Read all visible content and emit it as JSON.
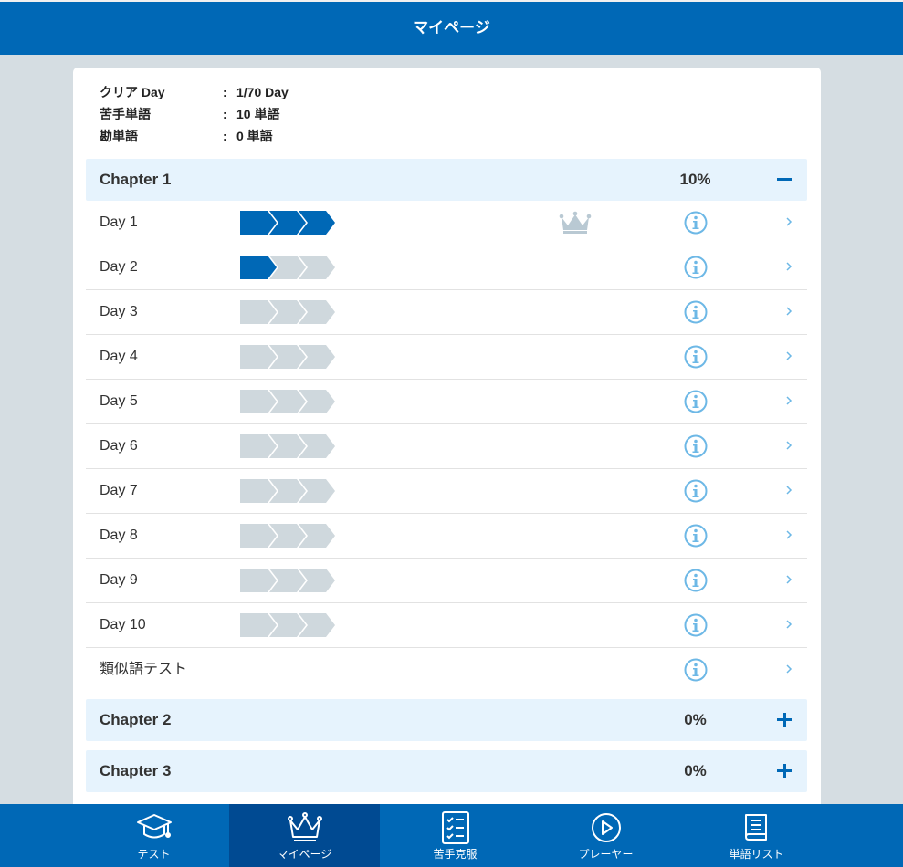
{
  "header": {
    "title": "マイページ"
  },
  "summary": [
    {
      "label": "クリア Day",
      "sep": ":",
      "value": "1/70 Day"
    },
    {
      "label": "苦手単語",
      "sep": ":",
      "value": "10 単語"
    },
    {
      "label": "勘単語",
      "sep": ":",
      "value": "0 単語"
    }
  ],
  "chapters": [
    {
      "name": "Chapter 1",
      "percent": "10%",
      "expanded": true
    },
    {
      "name": "Chapter 2",
      "percent": "0%",
      "expanded": false
    },
    {
      "name": "Chapter 3",
      "percent": "0%",
      "expanded": false
    }
  ],
  "days": [
    {
      "label": "Day 1",
      "progress": 3,
      "crown": true
    },
    {
      "label": "Day 2",
      "progress": 1,
      "crown": false
    },
    {
      "label": "Day 3",
      "progress": 0,
      "crown": false
    },
    {
      "label": "Day 4",
      "progress": 0,
      "crown": false
    },
    {
      "label": "Day 5",
      "progress": 0,
      "crown": false
    },
    {
      "label": "Day 6",
      "progress": 0,
      "crown": false
    },
    {
      "label": "Day 7",
      "progress": 0,
      "crown": false
    },
    {
      "label": "Day 8",
      "progress": 0,
      "crown": false
    },
    {
      "label": "Day 9",
      "progress": 0,
      "crown": false
    },
    {
      "label": "Day 10",
      "progress": 0,
      "crown": false
    }
  ],
  "similar_test": {
    "label": "類似語テスト"
  },
  "icons": {
    "step": "chevron-step-icon",
    "crown": "crown-icon",
    "info": "info-icon",
    "chevron": "chevron-right-icon"
  },
  "colors": {
    "primary": "#0068b6",
    "active_tab": "#004a92",
    "step_done": "#0068b6",
    "step_todo": "#cfd8dd",
    "info": "#6db8e6",
    "crown": "#b9c9d3",
    "chapter_bg": "#e6f3fd"
  },
  "nav": {
    "active": 1,
    "tabs": [
      {
        "label": "テスト",
        "icon": "graduation-cap-icon"
      },
      {
        "label": "マイページ",
        "icon": "crown-icon"
      },
      {
        "label": "苦手克服",
        "icon": "checklist-icon"
      },
      {
        "label": "プレーヤー",
        "icon": "play-icon"
      },
      {
        "label": "単語リスト",
        "icon": "book-icon"
      }
    ]
  }
}
